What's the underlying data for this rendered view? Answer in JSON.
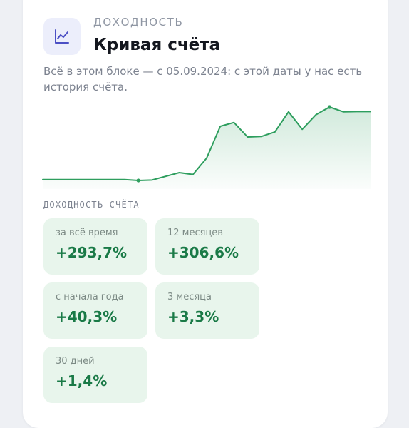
{
  "header": {
    "icon": "line-chart-icon",
    "eyebrow": "доходность",
    "title": "Кривая счёта",
    "description": "Всё в этом блоке — с 05.09.2024: с этой даты у нас есть история счёта."
  },
  "chart_data": {
    "type": "area",
    "title": "",
    "xlabel": "",
    "ylabel": "",
    "grid": false,
    "color": "#2e9e5e",
    "values": [
      1.5,
      1.5,
      1.5,
      1.5,
      1.5,
      1.5,
      1.5,
      0.2,
      0.8,
      6.5,
      12.1,
      9.3,
      34.2,
      82.5,
      88.2,
      66.2,
      67.0,
      73.9,
      104.4,
      77.9,
      99.9,
      111.7,
      104.4,
      104.8,
      104.8
    ],
    "highlights": [
      7,
      21
    ]
  },
  "metrics": {
    "section_label": "ДОХОДНОСТЬ СЧЁТА",
    "accent": "#1a7a47",
    "tile_bg": "#e8f5ec",
    "items": [
      {
        "label": "за всё время",
        "value": "+293,7%"
      },
      {
        "label": "12 месяцев",
        "value": "+306,6%"
      },
      {
        "label": "с начала года",
        "value": "+40,3%"
      },
      {
        "label": "3 месяца",
        "value": "+3,3%"
      },
      {
        "label": "30 дней",
        "value": "+1,4%"
      }
    ]
  }
}
